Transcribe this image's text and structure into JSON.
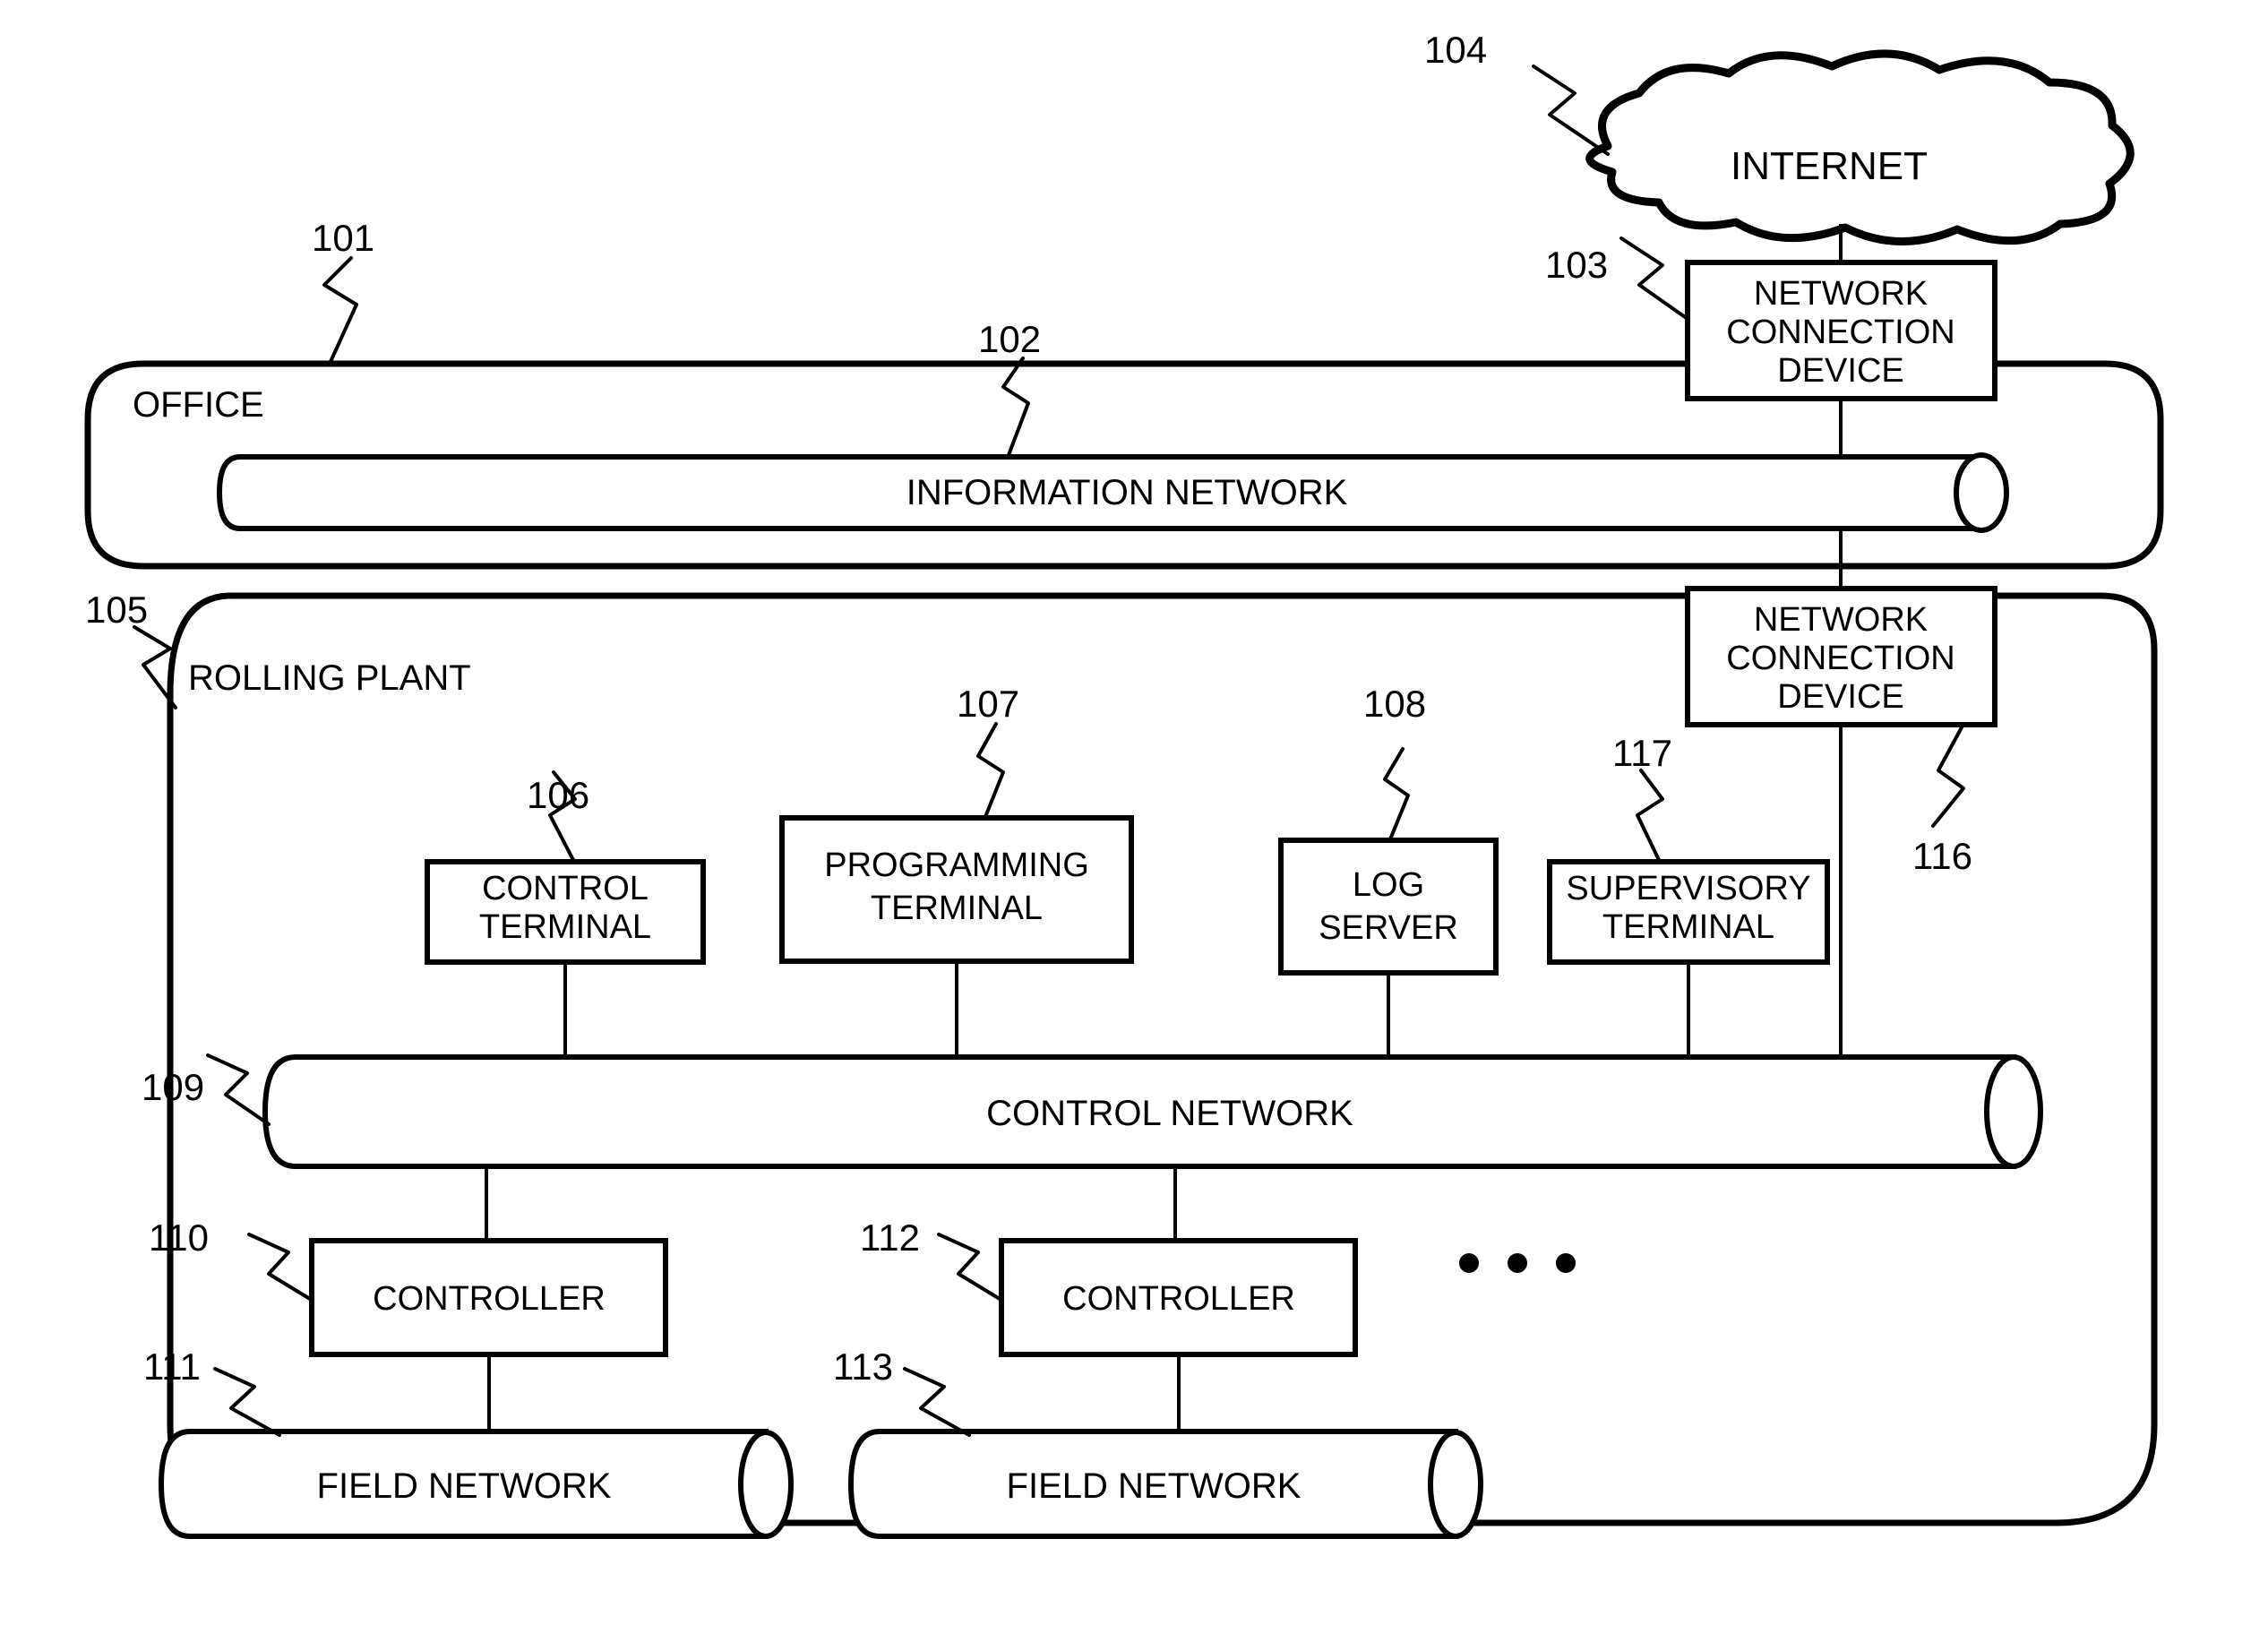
{
  "figure": {
    "type": "patent-network-diagram",
    "background_color": "#ffffff",
    "line_color": "#000000"
  },
  "zones": [
    {
      "key": "office",
      "ref": "101",
      "label": "OFFICE"
    },
    {
      "key": "rolling_plant",
      "ref": "105",
      "label": "ROLLING PLANT"
    }
  ],
  "cloud": {
    "ref": "104",
    "label": "INTERNET"
  },
  "network_connection_devices": [
    {
      "key": "ncd_office",
      "ref": "103",
      "lines": [
        "NETWORK",
        "CONNECTION",
        "DEVICE"
      ]
    },
    {
      "key": "ncd_plant",
      "ref": "",
      "lines": [
        "NETWORK",
        "CONNECTION",
        "DEVICE"
      ]
    }
  ],
  "networks": [
    {
      "key": "information_network",
      "ref": "102",
      "label": "INFORMATION NETWORK"
    },
    {
      "key": "control_network",
      "ref": "109",
      "label": "CONTROL NETWORK"
    },
    {
      "key": "field_network_1",
      "ref": "111",
      "label": "FIELD NETWORK"
    },
    {
      "key": "field_network_2",
      "ref": "113",
      "label": "FIELD NETWORK"
    }
  ],
  "terminals": [
    {
      "key": "control_terminal",
      "ref": "106",
      "lines": [
        "CONTROL",
        "TERMINAL"
      ]
    },
    {
      "key": "programming_terminal",
      "ref": "107",
      "lines": [
        "PROGRAMMING",
        "TERMINAL"
      ]
    },
    {
      "key": "log_server",
      "ref": "108",
      "lines": [
        "LOG",
        "SERVER"
      ]
    },
    {
      "key": "supervisory_terminal",
      "ref": "117",
      "lines": [
        "SUPERVISORY",
        "TERMINAL"
      ]
    }
  ],
  "controllers": [
    {
      "key": "controller_1",
      "ref": "110",
      "label": "CONTROLLER"
    },
    {
      "key": "controller_2",
      "ref": "112",
      "label": "CONTROLLER"
    }
  ],
  "connection_link": {
    "key": "plant_uplink",
    "ref": "116"
  },
  "ellipsis": {
    "label": "...",
    "dot_count": 3
  }
}
